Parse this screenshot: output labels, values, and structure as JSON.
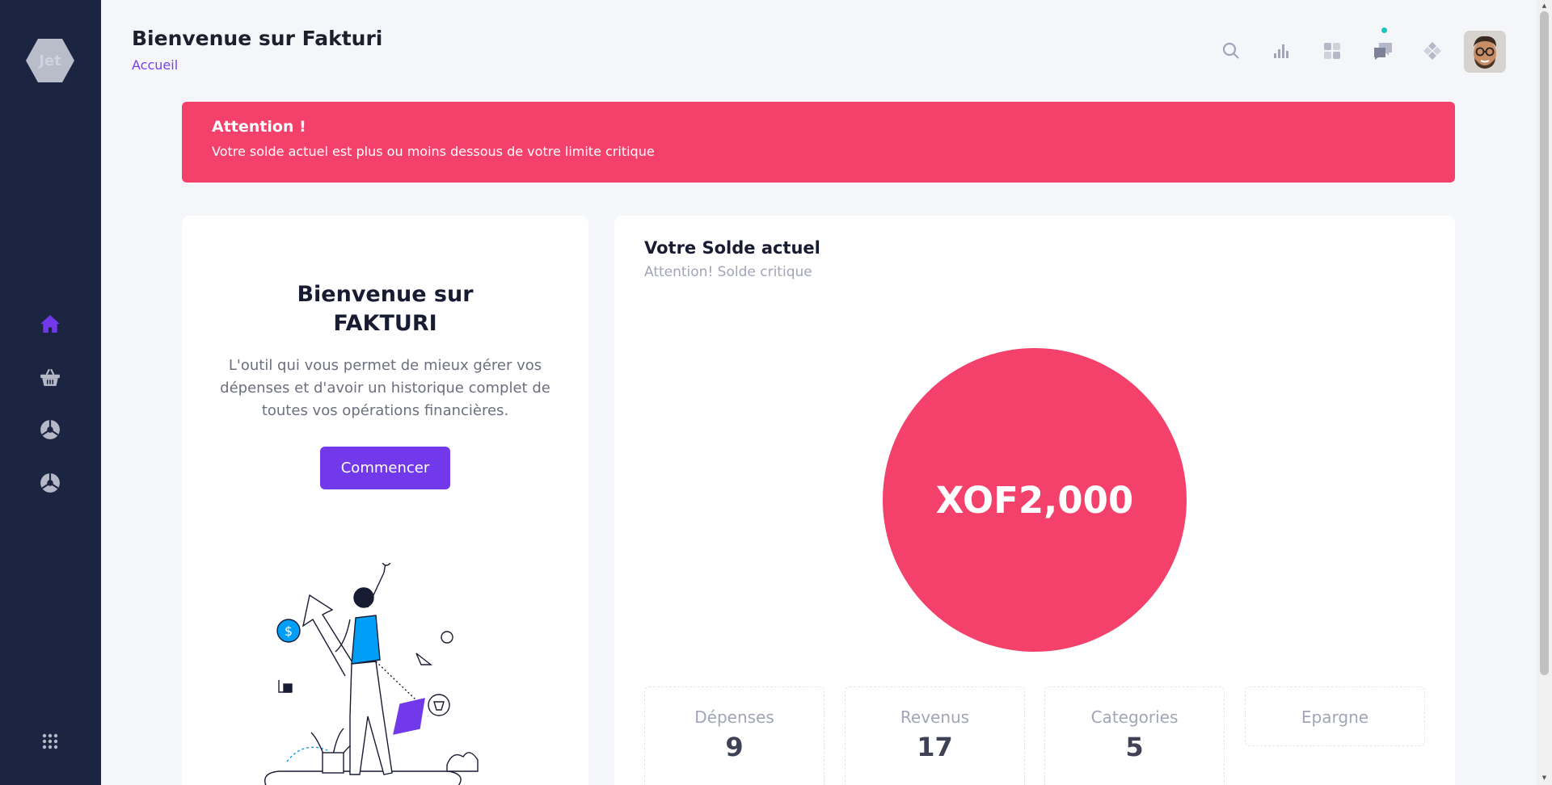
{
  "sidebar": {
    "logo_text": "Jet",
    "items": [
      {
        "icon": "home-icon",
        "active": true
      },
      {
        "icon": "basket-icon",
        "active": false
      },
      {
        "icon": "chart-pie-icon",
        "active": false
      },
      {
        "icon": "chart-pie-icon",
        "active": false
      }
    ],
    "bottom_icon": "apps-grid-icon"
  },
  "header": {
    "title": "Bienvenue sur Fakturi",
    "breadcrumb": "Accueil",
    "icons": [
      "search-icon",
      "bar-chart-icon",
      "grid-icon",
      "chat-icon",
      "layers-icon"
    ]
  },
  "alert": {
    "title": "Attention !",
    "text": "Votre solde actuel est plus ou moins dessous de votre limite critique"
  },
  "welcome": {
    "title_line1": "Bienvenue sur",
    "title_line2": "FAKTURI",
    "description": "L'outil qui vous permet de mieux gérer vos dépenses et d'avoir un historique complet de toutes vos opérations financières.",
    "button": "Commencer"
  },
  "balance": {
    "title": "Votre Solde actuel",
    "subtitle": "Attention! Solde critique",
    "amount": "XOF2,000"
  },
  "stats": [
    {
      "label": "Dépenses",
      "value": "9"
    },
    {
      "label": "Revenus",
      "value": "17"
    },
    {
      "label": "Categories",
      "value": "5"
    },
    {
      "label": "Epargne",
      "value": ""
    }
  ],
  "colors": {
    "sidebar": "#1b2541",
    "accent": "#7239ea",
    "danger": "#f3416b"
  }
}
